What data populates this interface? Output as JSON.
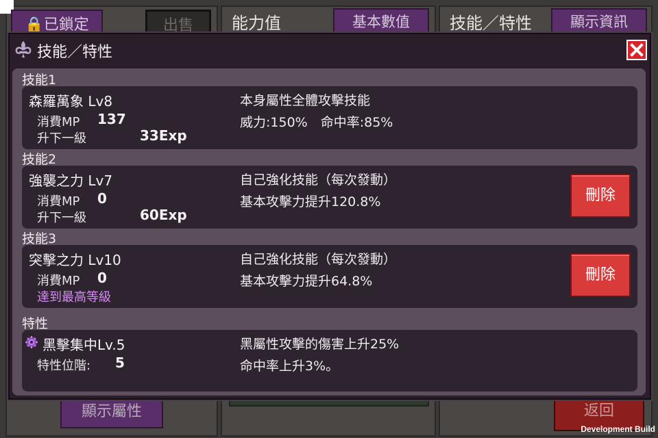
{
  "background": {
    "lock_label": "已鎖定",
    "sell_label": "出售",
    "stats_title": "能力值",
    "stats_button": "基本數值",
    "skills_title": "技能／特性",
    "info_button": "顯示資訊",
    "attr_button": "顯示屬性",
    "back_button": "返回"
  },
  "dialog": {
    "title": "技能／特性",
    "icon": "fleur-de-lis-icon",
    "close_icon": "close-icon"
  },
  "skills": [
    {
      "section_label": "技能1",
      "name": "森羅萬象 Lv8",
      "mp_label": "消費MP",
      "mp_value": "137",
      "next_label": "升下一級",
      "next_value": "33Exp",
      "desc1": "本身屬性全體攻擊技能",
      "desc2": "威力:150%　命中率:85%"
    },
    {
      "section_label": "技能2",
      "name": "強襲之力 Lv7",
      "mp_label": "消費MP",
      "mp_value": "0",
      "next_label": "升下一級",
      "next_value": "60Exp",
      "desc1": "自己強化技能（每次發動）",
      "desc2": "基本攻擊力提升120.8%",
      "delete_label": "刪除"
    },
    {
      "section_label": "技能3",
      "name": "突擊之力 Lv10",
      "mp_label": "消費MP",
      "mp_value": "0",
      "maxed_label": "達到最高等級",
      "desc1": "自己強化技能（每次發動）",
      "desc2": "基本攻擊力提升64.8%",
      "delete_label": "刪除"
    }
  ],
  "trait": {
    "section_label": "特性",
    "icon": "dark-element-icon",
    "name": "黑擊集中Lv.5",
    "rank_label": "特性位階:",
    "rank_value": "5",
    "desc1": "黑屬性攻擊的傷害上升25%",
    "desc2": "命中率上升3%。"
  },
  "footer": {
    "build_label": "Development Build"
  },
  "colors": {
    "dialog_bg": "#2b1e2b",
    "body_bg": "#5c4e5c",
    "card_bg": "#2e2430",
    "delete_red": "#d93a3a",
    "maxed_purple": "#d48cf0"
  }
}
